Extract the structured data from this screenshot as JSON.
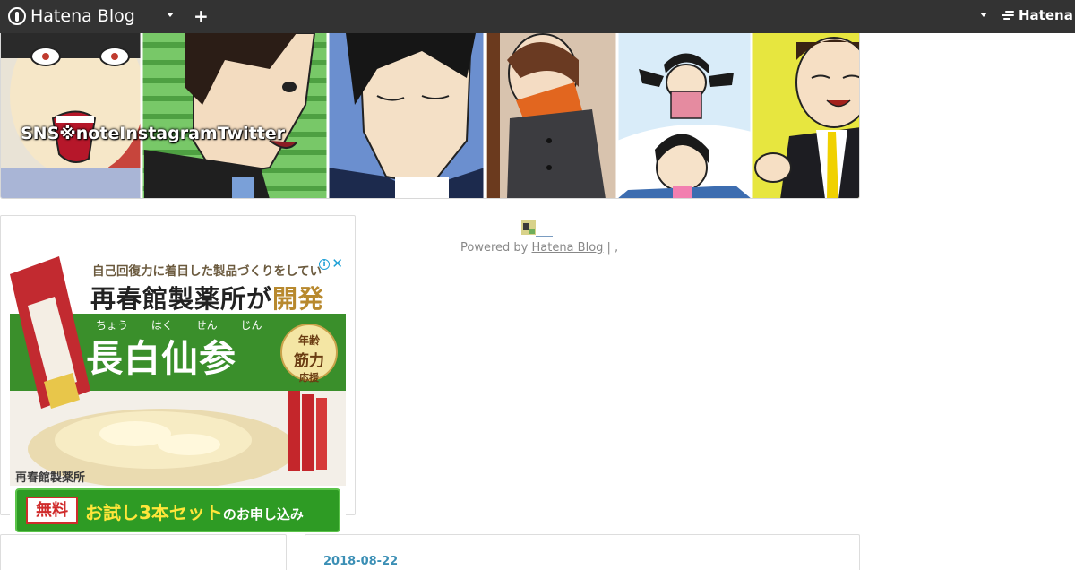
{
  "topbar": {
    "brand_label": "Hatena Blog",
    "brand_icon": "hatena-blog-logo-icon",
    "menu_caret_icon": "chevron-down-icon",
    "add_icon": "plus-icon",
    "add_label": "+",
    "account_caret_icon": "chevron-down-icon",
    "hatena_label": "Hatena",
    "background": "#333333"
  },
  "header": {
    "blog_title": "SNS※noteInstagramTwitter"
  },
  "ad": {
    "choices_label": "i",
    "close_label": "✕",
    "tagline": "自己回復力に着目した製品づくりをしてい",
    "headline_main": "再春館製薬所が",
    "headline_highlight": "開発",
    "ruby": "ちょう はく せん じん",
    "product_name": "長白仙参",
    "badge_line1": "年齢",
    "badge_line2": "筋力",
    "badge_line3": "応援",
    "company": "再春館製薬所",
    "cta_free": "無料",
    "cta_main": "お試し3本セット",
    "cta_suffix": "のお申し込み",
    "accent_green": "#3a8f2b"
  },
  "footer": {
    "powered_prefix": "Powered by ",
    "powered_link": "Hatena Blog",
    "powered_suffix": " | ,"
  },
  "entry": {
    "date": "2018-08-22"
  }
}
